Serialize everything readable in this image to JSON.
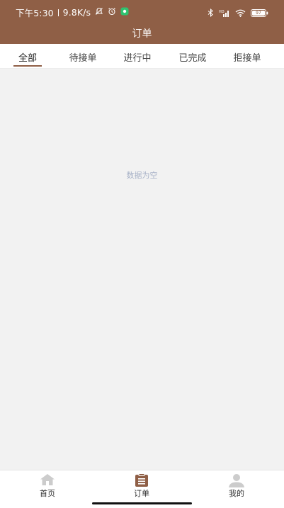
{
  "status_bar": {
    "time": "下午5:30",
    "speed": "9.8K/s",
    "battery": "97",
    "icons": [
      "mute-icon",
      "alarm-icon",
      "notification-dot-icon",
      "bluetooth-icon",
      "signal-icon",
      "wifi-icon",
      "battery-icon"
    ]
  },
  "header": {
    "title": "订单"
  },
  "tabs": [
    {
      "label": "全部",
      "active": true
    },
    {
      "label": "待接单",
      "active": false
    },
    {
      "label": "进行中",
      "active": false
    },
    {
      "label": "已完成",
      "active": false
    },
    {
      "label": "拒接单",
      "active": false
    }
  ],
  "empty_state": {
    "text": "数据为空"
  },
  "bottom_nav": {
    "items": [
      {
        "label": "首页",
        "icon": "home-icon",
        "active": false
      },
      {
        "label": "订单",
        "icon": "order-icon",
        "active": true
      },
      {
        "label": "我的",
        "icon": "user-icon",
        "active": false
      }
    ]
  },
  "colors": {
    "brand": "#8f5f46",
    "background": "#f2f2f2",
    "inactive_icon": "#cccccc",
    "empty_text": "#a9b3c8"
  }
}
